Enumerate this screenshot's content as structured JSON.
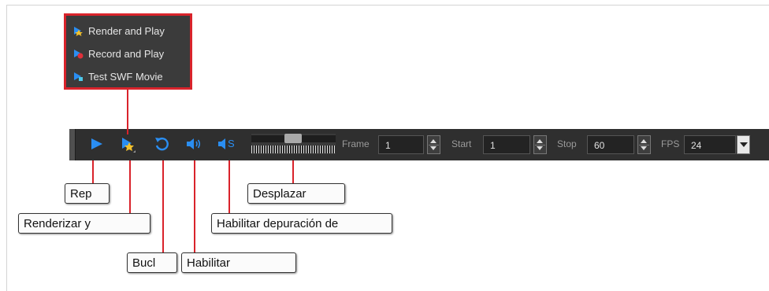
{
  "popup_menu": {
    "items": [
      {
        "label": "Render and Play",
        "icon": "render-and-play-icon"
      },
      {
        "label": "Record and Play",
        "icon": "record-and-play-icon"
      },
      {
        "label": "Test SWF Movie",
        "icon": "test-swf-movie-icon"
      }
    ]
  },
  "toolbar": {
    "icons": [
      "play-icon",
      "render-and-play-icon",
      "loop-icon",
      "sound-icon",
      "sound-scrubbing-icon"
    ],
    "sound_scrub_letter": "S",
    "frame_label": "Frame",
    "frame_value": "1",
    "start_label": "Start",
    "start_value": "1",
    "stop_label": "Stop",
    "stop_value": "60",
    "fps_label": "FPS",
    "fps_value": "24"
  },
  "callouts": {
    "play": "Rep",
    "render": "Renderizar y",
    "loop": "Bucl",
    "sound": "Habilitar",
    "sound_scrub": "Habilitar depuración de",
    "scrub": "Desplazar"
  },
  "colors": {
    "accent_red": "#d9232b",
    "toolbar_bg": "#2f2f2f",
    "icon_blue": "#2a8ef2",
    "popup_bg": "#3b3b3b"
  }
}
